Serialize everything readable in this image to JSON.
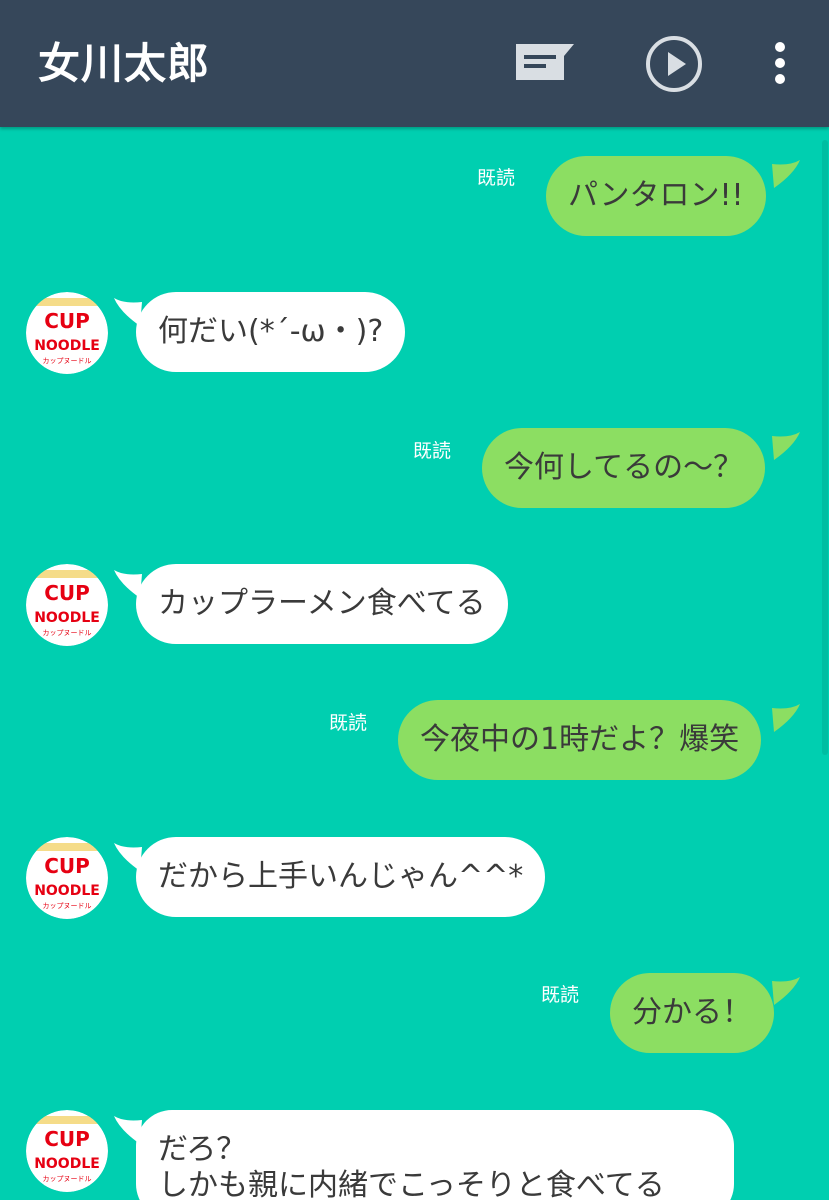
{
  "header": {
    "title": "女川太郎",
    "icons": [
      "notes-icon",
      "play-icon",
      "more-icon"
    ],
    "background": "#36475A"
  },
  "chat": {
    "background": "#00CFB0",
    "outgoing_color": "#8CDE62",
    "incoming_color": "#FFFFFF",
    "read_label": "既読",
    "messages": [
      {
        "side": "out",
        "text": "パンタロン!!",
        "read": "既読"
      },
      {
        "side": "in",
        "text": "何だい(*´-ω・)?"
      },
      {
        "side": "out",
        "text": "今何してるの～？",
        "read": "既読"
      },
      {
        "side": "in",
        "text": "カップラーメン食べてる"
      },
      {
        "side": "out",
        "text": "今夜中の1時だよ？爆笑",
        "read": "既読"
      },
      {
        "side": "in",
        "text": "だから上手いんじゃん^^*"
      },
      {
        "side": "out",
        "text": "分かる！",
        "read": "既読"
      },
      {
        "side": "in",
        "lines": [
          "だろ？",
          "しかも親に内緒でこっそりと食べてる"
        ]
      }
    ]
  },
  "avatar": {
    "brand_top": "CUP",
    "brand_bottom": "NOODLE",
    "brand_sub": "カップヌードル",
    "brand_color": "#E60012"
  }
}
